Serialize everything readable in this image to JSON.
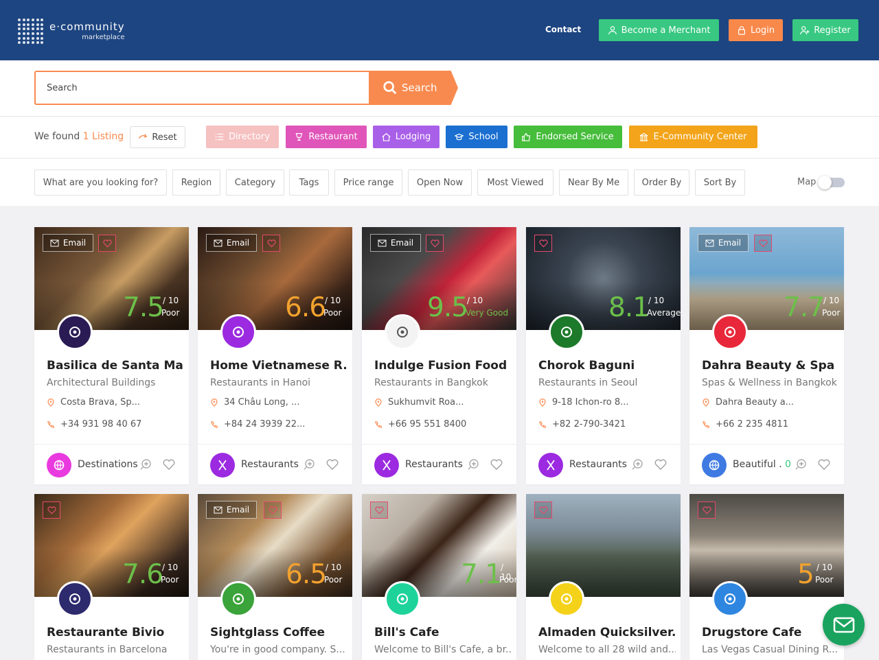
{
  "header": {
    "logo_main": "e·community",
    "logo_sub": "marketplace",
    "contact": "Contact",
    "merchant": "Become a Merchant",
    "login": "Login",
    "register": "Register"
  },
  "search": {
    "placeholder": "Search",
    "button": "Search"
  },
  "results": {
    "prefix": "We found ",
    "count": "1 Listing",
    "reset": "Reset"
  },
  "categories": [
    {
      "label": "Directory",
      "color": "#f6c1c1",
      "icon": "list-icon"
    },
    {
      "label": "Restaurant",
      "color": "#e055b9",
      "icon": "cup-icon"
    },
    {
      "label": "Lodging",
      "color": "#a960e8",
      "icon": "home-icon"
    },
    {
      "label": "School",
      "color": "#1a6fd1",
      "icon": "graduation-icon"
    },
    {
      "label": "Endorsed Service",
      "color": "#46bd3b",
      "icon": "thumbs-up-icon"
    },
    {
      "label": "E-Community Center",
      "color": "#f3a41a",
      "icon": "building-icon"
    }
  ],
  "filters": [
    "What are you looking for?",
    "Region",
    "Category",
    "Tags",
    "Price range",
    "Open Now",
    "Most Viewed",
    "Near By Me",
    "Order By",
    "Sort By"
  ],
  "map_label": "Map",
  "email_label": "Email",
  "cards": [
    {
      "score": "7.5",
      "of": "/ 10",
      "rating": "Poor",
      "score_color": "#6cc04a",
      "title": "Basilica de Santa Ma...",
      "subtitle": "Architectural Buildings",
      "address": "Costa Brava, Sp...",
      "phone": "+34 931 98 40 67",
      "category": "Destinations",
      "cat_color": "#e93ae0",
      "avatar_color": "#2a1b54",
      "email": true
    },
    {
      "score": "6.6",
      "of": "/ 10",
      "rating": "Poor",
      "score_color": "#f2a22e",
      "title": "Home Vietnamese R...",
      "subtitle": "Restaurants in Hanoi",
      "address": "34 Châu Long, ...",
      "phone": "+84 24 3939 22...",
      "category": "Restaurants",
      "cat_color": "#9b2ae0",
      "avatar_color": "#9b2ae0",
      "email": true
    },
    {
      "score": "9.5",
      "of": "/ 10",
      "rating": "Very Good",
      "score_color": "#6cc04a",
      "title": "Indulge Fusion Food ...",
      "subtitle": "Restaurants in Bangkok",
      "address": "Sukhumvit Roa...",
      "phone": "+66 95 551 8400",
      "category": "Restaurants",
      "cat_color": "#9b2ae0",
      "avatar_color": "#f3f3f3",
      "email": true
    },
    {
      "score": "8.1",
      "of": "/ 10",
      "rating": "Average",
      "score_color": "#6cc04a",
      "title": "Chorok Baguni",
      "subtitle": "Restaurants in Seoul",
      "address": "9-18 Ichon-ro 8...",
      "phone": "+82 2-790-3421",
      "category": "Restaurants",
      "cat_color": "#9b2ae0",
      "avatar_color": "#1d7a2a",
      "email": false
    },
    {
      "score": "7.7",
      "of": "/ 10",
      "rating": "Poor",
      "score_color": "#6cc04a",
      "title": "Dahra Beauty & Spa",
      "subtitle": "Spas & Wellness in Bangkok",
      "address": "Dahra Beauty a...",
      "phone": "+66 2 235 4811",
      "category": "Beautiful",
      "cat_num": "0",
      "cat_color": "#3f7ae3",
      "avatar_color": "#e8283a",
      "email": true
    },
    {
      "score": "7.6",
      "of": "/ 10",
      "rating": "Poor",
      "score_color": "#6cc04a",
      "title": "Restaurante Bivio",
      "subtitle": "Restaurants in Barcelona",
      "avatar_color": "#2d2a6e",
      "email": false
    },
    {
      "score": "6.5",
      "of": "/ 10",
      "rating": "Poor",
      "score_color": "#f2a22e",
      "title": "Sightglass Coffee",
      "subtitle": "You're in good company. S...",
      "avatar_color": "#3aa33a",
      "email": true
    },
    {
      "score": "7.1",
      "of": "/ 10",
      "rating": "Poor",
      "score_color": "#6cc04a",
      "title": "Bill's Cafe",
      "subtitle": "Welcome to Bill's Cafe, a br...",
      "avatar_color": "#1ed39a",
      "email": false
    },
    {
      "score": "",
      "of": "",
      "rating": "",
      "score_color": "#6cc04a",
      "title": "Almaden Quicksilver...",
      "subtitle": "Welcome to all 28 wild and...",
      "avatar_color": "#f4d21a",
      "email": false
    },
    {
      "score": "5",
      "of": "/ 10",
      "rating": "Poor",
      "score_color": "#f2a22e",
      "title": "Drugstore Cafe",
      "subtitle": "Las Vegas Casual Dining R...",
      "avatar_color": "#2f86e0",
      "email": false
    }
  ]
}
